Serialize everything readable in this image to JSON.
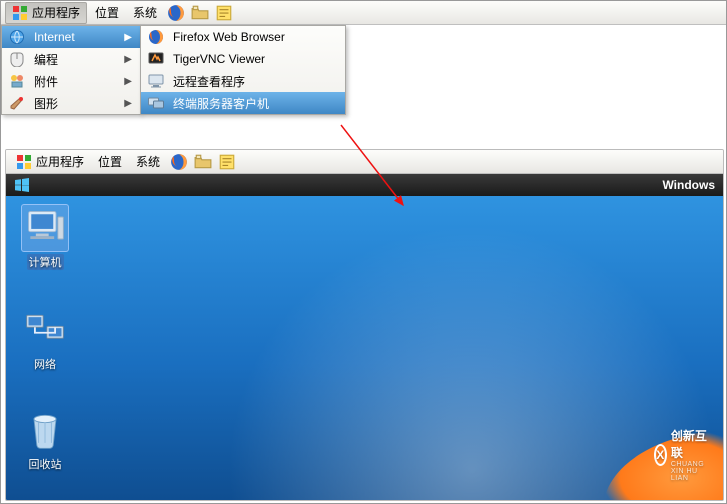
{
  "top_panel": {
    "apps_label": "应用程序",
    "places_label": "位置",
    "system_label": "系统",
    "icons": [
      "firefox-icon",
      "file-manager-icon",
      "notepad-icon"
    ]
  },
  "apps_menu": {
    "items": [
      {
        "icon": "globe-icon",
        "label": "Internet",
        "submenu": true,
        "selected": true
      },
      {
        "icon": "mouse-icon",
        "label": "编程",
        "submenu": true
      },
      {
        "icon": "media-icon",
        "label": "附件",
        "submenu": true
      },
      {
        "icon": "brush-icon",
        "label": "图形",
        "submenu": true
      }
    ]
  },
  "internet_submenu": {
    "items": [
      {
        "icon": "firefox-icon",
        "label": "Firefox Web Browser"
      },
      {
        "icon": "tigervnc-icon",
        "label": "TigerVNC Viewer"
      },
      {
        "icon": "monitor-icon",
        "label": "远程查看程序"
      },
      {
        "icon": "terminal-server-icon",
        "label": "终端服务器客户机",
        "selected": true
      }
    ]
  },
  "inner_panel": {
    "apps_label": "应用程序",
    "places_label": "位置",
    "system_label": "系统",
    "icons": [
      "firefox-icon",
      "file-manager-icon",
      "notepad-icon"
    ]
  },
  "inner_window": {
    "title": "Windows"
  },
  "desktop_icons": {
    "computer": "计算机",
    "network": "网络",
    "recycle": "回收站"
  },
  "watermark": {
    "text": "创新互联",
    "sub": "CHUANG XIN HU LIAN",
    "logo_letter": "X"
  }
}
